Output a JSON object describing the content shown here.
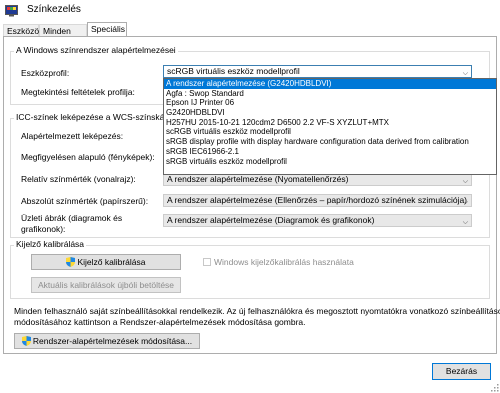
{
  "window": {
    "title": "Színkezelés"
  },
  "tabs": [
    {
      "label": "Eszközök"
    },
    {
      "label": "Minden profil"
    },
    {
      "label": "Speciális"
    }
  ],
  "default_system": {
    "group_title": "A Windows színrendszer alapértelmezései",
    "device_profile_label": "Eszközprofil:",
    "device_profile_value": "scRGB virtuális eszköz modellprofil",
    "viewing_conditions_label": "Megtekintési feltételek profilja:"
  },
  "dropdown": {
    "items": [
      "A rendszer alapértelmezése (G2420HDBLDVI)",
      "Agfa : Swop Standard",
      "Epson IJ Printer 06",
      "G2420HDBLDVI",
      "H257HU 2015-10-21 120cdm2 D6500 2.2 VF-S XYZLUT+MTX",
      "scRGB virtuális eszköz modellprofil",
      "sRGB display profile with display hardware configuration data derived from calibration",
      "sRGB IEC61966-2.1",
      "sRGB virtuális eszköz modellprofil"
    ]
  },
  "icc": {
    "group_title": "ICC-színek leképezése a WCS-színskálára",
    "default_rendering_label": "Alapértelmezett leképezés:",
    "perceptual_label": "Megfigyelésen alapuló (fényképek):",
    "relative_label": "Relatív színmérték (vonalrajz):",
    "relative_value": "A rendszer alapértelmezése (Nyomatellenőrzés)",
    "absolute_label": "Abszolút színmérték (papírszerű):",
    "absolute_value": "A rendszer alapértelmezése (Ellenőrzés – papír/hordozó színének szimulációja)",
    "business_label_line1": "Üzleti ábrák (diagramok és",
    "business_label_line2": "grafikonok):",
    "business_value": "A rendszer alapértelmezése (Diagramok és grafikonok)"
  },
  "calibration": {
    "group_title": "Kijelző kalibrálása",
    "calibrate_button": "Kijelző kalibrálása",
    "windows_calibration_checkbox": "Windows kijelzőkalibrálás használata",
    "reload_button": "Aktuális kalibrálások újbóli betöltése"
  },
  "info_text_line1": "Minden felhasználó saját színbeállításokkal rendelkezik. Az új felhasználókra és megosztott nyomtatókra vonatkozó színbeállítások",
  "info_text_line2": "módosításához kattintson a Rendszer-alapértelmezések módosítása gombra.",
  "change_defaults_button": "Rendszer-alapértelmezések módosítása...",
  "close_button": "Bezárás",
  "colors": {
    "selection": "#0078d7",
    "accent_border": "#0078d7"
  }
}
